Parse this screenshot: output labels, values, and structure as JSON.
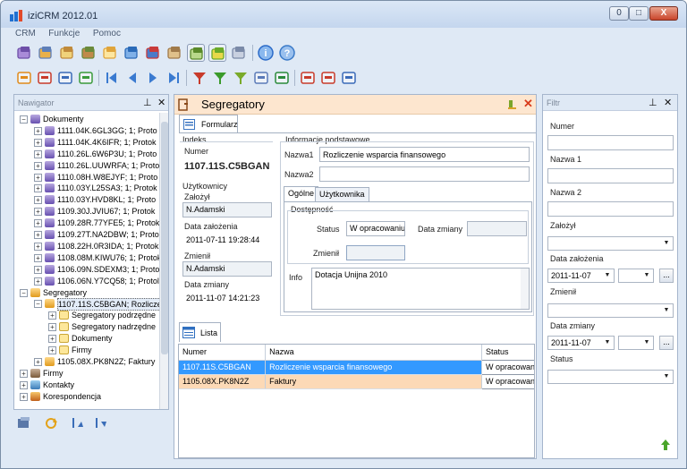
{
  "window": {
    "title": "iziCRM 2012.01",
    "min": "0",
    "max": "□",
    "close": "X"
  },
  "menu": [
    "CRM",
    "Funkcje",
    "Pomoc"
  ],
  "navigator": {
    "title": "Nawigator",
    "pin": "ᵖ",
    "close": "✕",
    "tree": [
      {
        "level": 0,
        "exp": "−",
        "icon": "doc",
        "label": "Dokumenty"
      },
      {
        "level": 1,
        "exp": "+",
        "icon": "doc",
        "label": "1111.04K.6GL3GG; 1; Proto"
      },
      {
        "level": 1,
        "exp": "+",
        "icon": "doc",
        "label": "1111.04K.4K6IFR; 1; Protok"
      },
      {
        "level": 1,
        "exp": "+",
        "icon": "doc",
        "label": "1110.26L.6W6P3U; 1; Proto"
      },
      {
        "level": 1,
        "exp": "+",
        "icon": "doc",
        "label": "1110.26L.UUWRFA; 1; Proto"
      },
      {
        "level": 1,
        "exp": "+",
        "icon": "doc",
        "label": "1110.08H.W8EJYF; 1; Proto"
      },
      {
        "level": 1,
        "exp": "+",
        "icon": "doc",
        "label": "1110.03Y.L25SA3; 1; Protok"
      },
      {
        "level": 1,
        "exp": "+",
        "icon": "doc",
        "label": "1110.03Y.HVD8KL; 1; Proto"
      },
      {
        "level": 1,
        "exp": "+",
        "icon": "doc",
        "label": "1109.30J.JVIU67; 1; Protok"
      },
      {
        "level": 1,
        "exp": "+",
        "icon": "doc",
        "label": "1109.28R.77YFE5; 1; Protok"
      },
      {
        "level": 1,
        "exp": "+",
        "icon": "doc",
        "label": "1109.27T.NA2DBW; 1; Proto"
      },
      {
        "level": 1,
        "exp": "+",
        "icon": "doc",
        "label": "1108.22H.0R3IDA; 1; Protok"
      },
      {
        "level": 1,
        "exp": "+",
        "icon": "doc",
        "label": "1108.08M.KIWU76; 1; Protok"
      },
      {
        "level": 1,
        "exp": "+",
        "icon": "doc",
        "label": "1106.09N.SDEXM3; 1; Protok"
      },
      {
        "level": 1,
        "exp": "+",
        "icon": "doc",
        "label": "1106.06N.Y7CQ58; 1; Protol"
      },
      {
        "level": 0,
        "exp": "−",
        "icon": "seg",
        "label": "Segregatory"
      },
      {
        "level": 1,
        "exp": "−",
        "icon": "seg",
        "label": "1107.11S.C5BGAN; Rozlicze",
        "selected": true
      },
      {
        "level": 2,
        "exp": "+",
        "icon": "fold",
        "label": "Segregatory podrzędne"
      },
      {
        "level": 2,
        "exp": "+",
        "icon": "fold",
        "label": "Segregatory nadrzędne"
      },
      {
        "level": 2,
        "exp": "+",
        "icon": "fold",
        "label": "Dokumenty"
      },
      {
        "level": 2,
        "exp": "+",
        "icon": "fold",
        "label": "Firmy"
      },
      {
        "level": 1,
        "exp": "+",
        "icon": "seg",
        "label": "1105.08X.PK8N2Z; Faktury"
      },
      {
        "level": 0,
        "exp": "+",
        "icon": "firm",
        "label": "Firmy"
      },
      {
        "level": 0,
        "exp": "+",
        "icon": "kon",
        "label": "Kontakty"
      },
      {
        "level": 0,
        "exp": "+",
        "icon": "kor",
        "label": "Korespondencja"
      }
    ]
  },
  "main": {
    "header": "Segregatory",
    "form_tab": "Formularz",
    "indeks": {
      "group": "Indeks",
      "numer_label": "Numer",
      "numer": "1107.11S.C5BGAN"
    },
    "uzytkownicy": {
      "group": "Użytkownicy",
      "zalozyl_label": "Założył",
      "zalozyl": "N.Adamski",
      "data_zal_label": "Data założenia",
      "data_zal": "2011-07-11 19:28:44",
      "zmienil_label": "Zmienił",
      "zmienil": "N.Adamski",
      "data_zm_label": "Data zmiany",
      "data_zm": "2011-11-07 14:21:23"
    },
    "info_podst": {
      "group": "Informacje podstawowe",
      "nazwa1_label": "Nazwa1",
      "nazwa1": "Rozliczenie wsparcia finansowego",
      "nazwa2_label": "Nazwa2",
      "nazwa2": ""
    },
    "subtabs": [
      "Ogólne",
      "Użytkownika"
    ],
    "dostepnosc": {
      "group": "Dostępność",
      "status_label": "Status",
      "status": "W opracowaniu",
      "data_zm_label": "Data zmiany",
      "zmienil_label": "Zmienił"
    },
    "info": {
      "label": "Info",
      "value": "Dotacja Unijna 2010"
    },
    "lista_tab": "Lista",
    "table": {
      "columns": [
        "Numer",
        "Nazwa",
        "Status"
      ],
      "rows": [
        {
          "numer": "1107.11S.C5BGAN",
          "nazwa": "Rozliczenie wsparcia finansowego",
          "status": "W opracowaniu"
        },
        {
          "numer": "1105.08X.PK8N2Z",
          "nazwa": "Faktury",
          "status": "W opracowaniu"
        }
      ]
    }
  },
  "filter": {
    "title": "Filtr",
    "pin": "ᵖ",
    "close": "✕",
    "numer_label": "Numer",
    "nazwa1_label": "Nazwa 1",
    "nazwa2_label": "Nazwa 2",
    "zalozyl_label": "Założył",
    "data_zal_label": "Data założenia",
    "data_zal": "2011-11-07",
    "zmienil_label": "Zmienił",
    "data_zm_label": "Data zmiany",
    "data_zm": "2011-11-07",
    "status_label": "Status",
    "dots": "..."
  },
  "colors": {
    "header_bg": "#fde6cf",
    "row_selected": "#3399ff",
    "row_alt": "#fcd9b6",
    "accent": "#2b7bd6"
  }
}
